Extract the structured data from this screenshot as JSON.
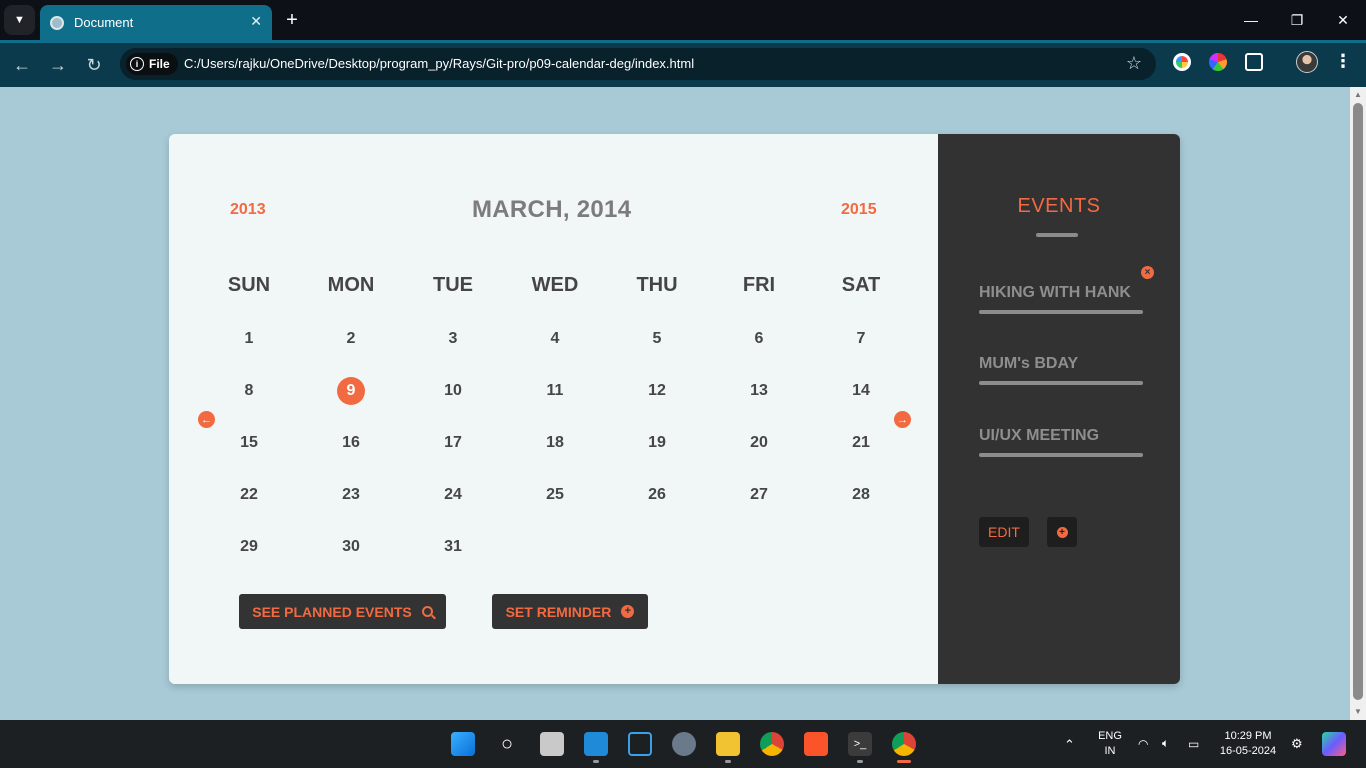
{
  "browser": {
    "tab_title": "Document",
    "tab_close": "✕",
    "new_tab": "+",
    "win_minimize": "—",
    "win_restore": "❐",
    "win_close": "✕",
    "file_chip": "File",
    "url": "C:/Users/rajku/OneDrive/Desktop/program_py/Rays/Git-pro/p09-calendar-deg/index.html"
  },
  "calendar": {
    "prev_year": "2013",
    "next_year": "2015",
    "month_title": "MARCH, 2014",
    "weekdays": [
      "SUN",
      "MON",
      "TUE",
      "WED",
      "THU",
      "FRI",
      "SAT"
    ],
    "days": [
      "1",
      "2",
      "3",
      "4",
      "5",
      "6",
      "7",
      "8",
      "9",
      "10",
      "11",
      "12",
      "13",
      "14",
      "15",
      "16",
      "17",
      "18",
      "19",
      "20",
      "21",
      "22",
      "23",
      "24",
      "25",
      "26",
      "27",
      "28",
      "29",
      "30",
      "31"
    ],
    "selected_day": "9",
    "prev_arrow": "←",
    "next_arrow": "→",
    "see_events_label": "SEE PLANNED EVENTS",
    "set_reminder_label": "SET REMINDER"
  },
  "events": {
    "title": "EVENTS",
    "items": [
      {
        "label": "HIKING WITH HANK"
      },
      {
        "label": "MUM's BDAY"
      },
      {
        "label": "UI/UX MEETING"
      }
    ],
    "edit_label": "EDIT"
  },
  "taskbar": {
    "language": "ENG",
    "region": "IN",
    "time": "10:29 PM",
    "date": "16-05-2024"
  },
  "colors": {
    "accent": "#f26a41",
    "page_bg": "#a8cad6",
    "panel_bg": "#323232",
    "calendar_bg": "#f1f6f6"
  }
}
